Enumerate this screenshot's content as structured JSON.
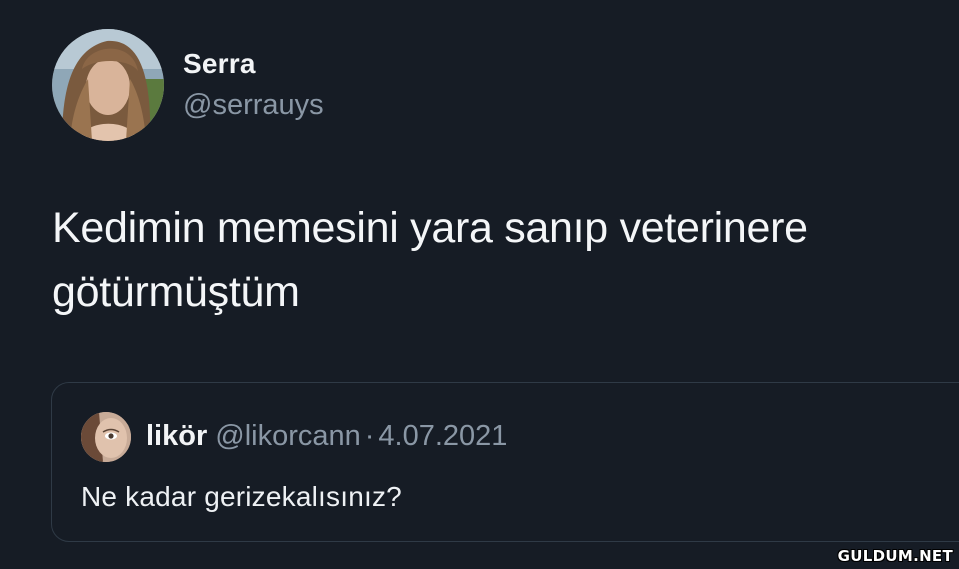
{
  "tweet": {
    "author_name": "Serra",
    "author_handle": "@serrauys",
    "avatar_icon": "profile-photo",
    "text": "Kedimin memesini yara sanıp veterinere götürmüştüm"
  },
  "quoted_tweet": {
    "author_name": "likör",
    "author_handle": "@likorcann",
    "separator": "·",
    "date": "4.07.2021",
    "avatar_icon": "profile-photo",
    "text": "Ne kadar gerizekalısınız?"
  },
  "watermark": "GULDUM.NET",
  "colors": {
    "background": "#161c25",
    "text_primary": "#f4f6f8",
    "text_secondary": "#8a97a5",
    "border": "#2f3a46"
  }
}
